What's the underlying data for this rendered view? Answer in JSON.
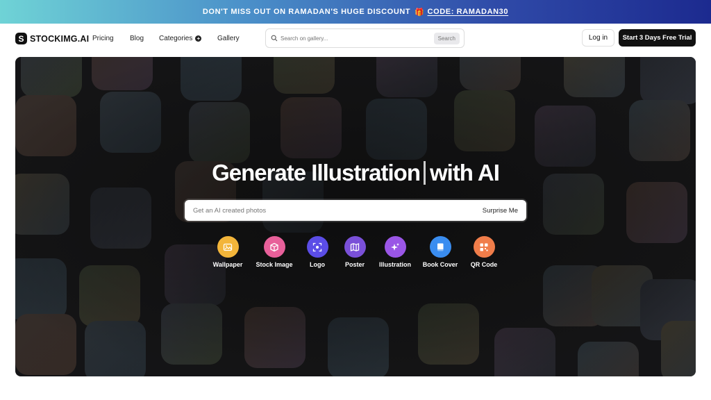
{
  "promo": {
    "text": "DON'T MISS OUT ON RAMADAN'S HUGE DISCOUNT",
    "code": "CODE: RAMADAN30"
  },
  "nav": {
    "brand": "STOCKIMG.AI",
    "links": [
      "Pricing",
      "Blog",
      "Categories",
      "Gallery"
    ],
    "search_placeholder": "Search on gallery...",
    "search_button": "Search",
    "login": "Log in",
    "trial": "Start 3 Days Free Trial"
  },
  "hero": {
    "title_left": "Generate Illustration",
    "title_right": "with AI",
    "prompt_placeholder": "Get an AI created photos",
    "surprise": "Surprise Me",
    "categories": [
      {
        "label": "Wallpaper",
        "color": "#f3b53a",
        "icon": "image-icon"
      },
      {
        "label": "Stock Image",
        "color": "#e8609a",
        "icon": "cube-icon"
      },
      {
        "label": "Logo",
        "color": "#5b4de6",
        "icon": "scan-icon"
      },
      {
        "label": "Poster",
        "color": "#7a50d8",
        "icon": "map-icon"
      },
      {
        "label": "Illustration",
        "color": "#9a56e6",
        "icon": "sparkle-icon"
      },
      {
        "label": "Book Cover",
        "color": "#3a8df0",
        "icon": "book-icon"
      },
      {
        "label": "QR Code",
        "color": "#f07d4a",
        "icon": "qr-icon"
      }
    ]
  }
}
